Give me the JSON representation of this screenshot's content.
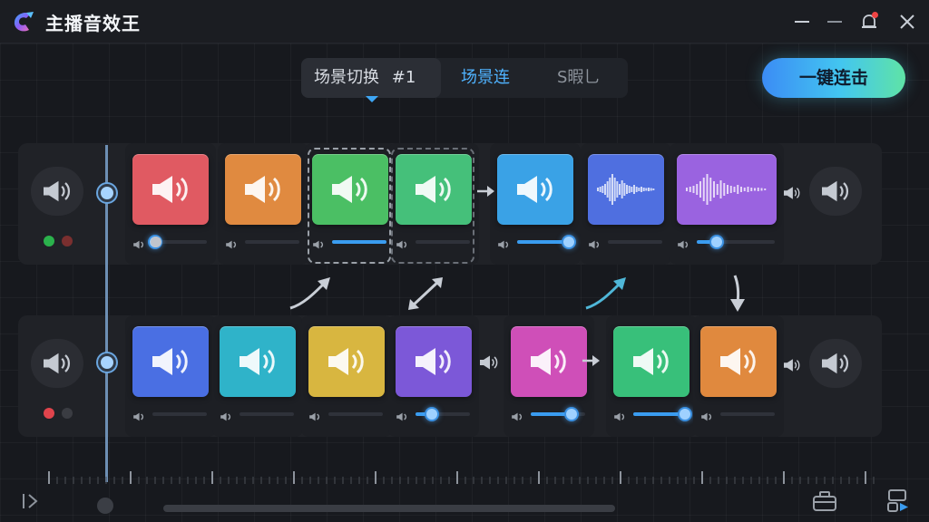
{
  "app": {
    "title": "主播音效王",
    "brand_colors": [
      "#3aa8ff",
      "#8b5cf6",
      "#f472b6"
    ]
  },
  "window_controls": [
    "minimize-icon",
    "restore-icon",
    "bell-icon",
    "close-icon"
  ],
  "scene_tabs": {
    "active_label": "场景切换",
    "active_index": "#1",
    "second_label": "场景连",
    "third_label": "S暇乚"
  },
  "combo_button": {
    "label": "一键连击"
  },
  "rows": [
    {
      "status_dots": [
        "#2bb24c",
        "#7a2f2f"
      ],
      "tiles": [
        {
          "color": "#e05a62",
          "icon": "speaker-icon",
          "volume": 0.05
        },
        {
          "color": "#e08a40",
          "icon": "speaker-icon",
          "volume": 0.0
        },
        {
          "color": "#4bbf64",
          "icon": "speaker-icon",
          "volume": 1.0,
          "selected": true
        },
        {
          "color": "#45c07a",
          "icon": "speaker-icon",
          "volume": 0.0,
          "selected": true
        },
        {
          "color": "#3aa2e6",
          "icon": "speaker-icon",
          "volume": 0.95
        },
        {
          "color": "#4f6fe0",
          "icon": "waveform-icon",
          "volume": 0.0
        },
        {
          "color": "#9a63e0",
          "icon": "waveform-icon",
          "volume": 0.25
        }
      ]
    },
    {
      "status_dots": [
        "#e0444c",
        "#3a3c42"
      ],
      "tiles": [
        {
          "color": "#4a6fe3",
          "icon": "speaker-icon",
          "volume": 0.0
        },
        {
          "color": "#2fb3c9",
          "icon": "speaker-icon",
          "volume": 0.0
        },
        {
          "color": "#d8b640",
          "icon": "speaker-icon",
          "volume": 0.0
        },
        {
          "color": "#7c58d8",
          "icon": "speaker-icon",
          "volume": 0.3
        },
        {
          "color": "#cf4fb8",
          "icon": "speaker-icon",
          "volume": 0.75
        },
        {
          "color": "#38c07a",
          "icon": "speaker-icon",
          "volume": 0.95
        },
        {
          "color": "#e0893e",
          "icon": "speaker-icon",
          "volume": 0.0
        }
      ]
    }
  ],
  "bottom": {
    "left_icon": "collapse-panel-icon",
    "right_icons": [
      "toolbox-icon",
      "export-icon"
    ]
  }
}
